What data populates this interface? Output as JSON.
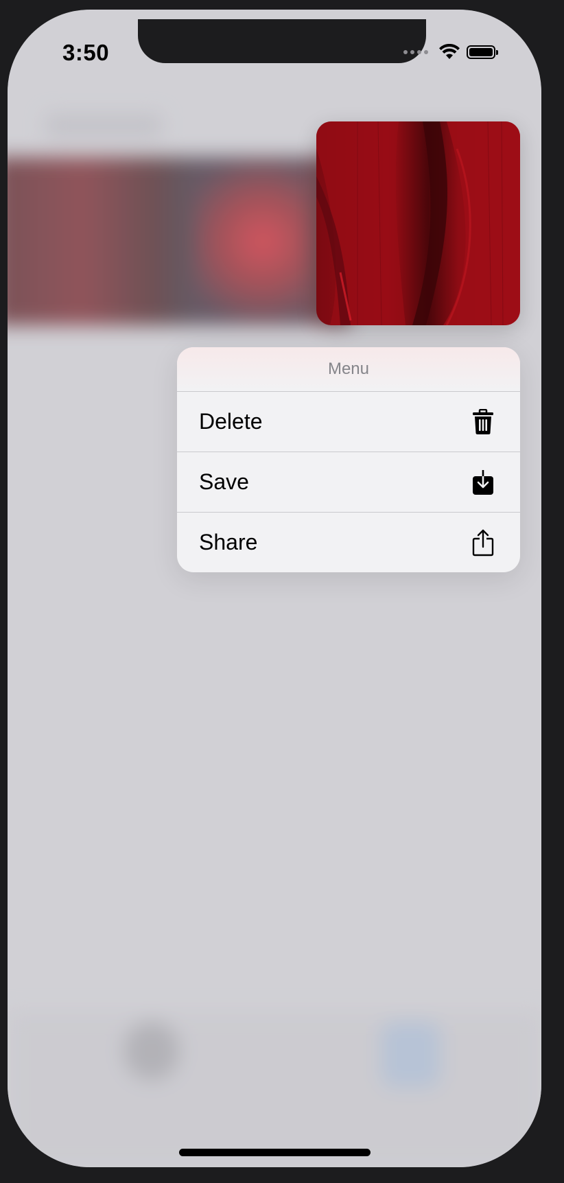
{
  "status_bar": {
    "time": "3:50",
    "icons": [
      "signal-dots-icon",
      "wifi-icon",
      "battery-icon"
    ]
  },
  "preview": {
    "description_icon": "red-leaf-photo"
  },
  "context_menu": {
    "title": "Menu",
    "items": [
      {
        "label": "Delete",
        "icon": "trash-icon"
      },
      {
        "label": "Save",
        "icon": "save-download-icon"
      },
      {
        "label": "Share",
        "icon": "share-icon"
      }
    ]
  },
  "colors": {
    "menu_background": "#f2f2f4",
    "screen_background": "#d1d0d5",
    "accent_red": "#a10c16"
  }
}
